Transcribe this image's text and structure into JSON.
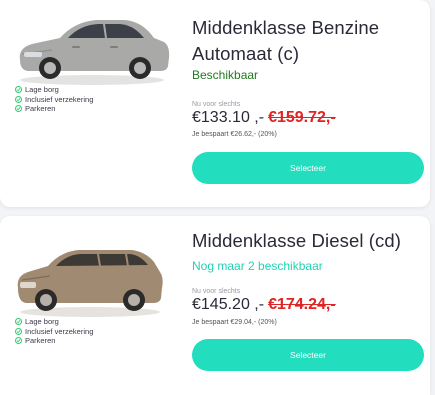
{
  "offers": [
    {
      "title": "Middenklasse Benzine Automaat (c)",
      "availability": "Beschikbaar",
      "now_label": "Nu voor slechts",
      "price": "€133.10 ,-",
      "old_price": "€159.72,-",
      "savings": "Je bespaart €26.62,- (20%)",
      "button_label": "Selecteer",
      "car_color": "#a9aaa7",
      "features": [
        "Lage borg",
        "Inclusief verzekering",
        "Parkeren"
      ]
    },
    {
      "title": "Middenklasse Diesel (cd)",
      "availability": "Nog maar 2 beschikbaar",
      "now_label": "Nu voor slechts",
      "price": "€145.20 ,-",
      "old_price": "€174.24,-",
      "savings": "Je bespaart €29.04,- (20%)",
      "button_label": "Selecteer",
      "car_color": "#a08a72",
      "features": [
        "Lage borg",
        "Inclusief verzekering",
        "Parkeren"
      ]
    }
  ],
  "colors": {
    "accent": "#22ddbe",
    "available_green": "#1f7a1f",
    "limited_teal": "#22d3b0",
    "old_price_red": "#e02424",
    "check_green": "#2ecc71"
  },
  "icons": {
    "feature": "check-circle-icon"
  }
}
